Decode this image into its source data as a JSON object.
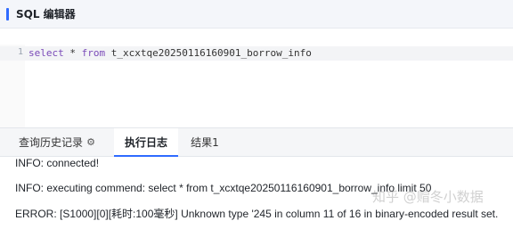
{
  "header": {
    "title": "SQL 编辑器"
  },
  "editor": {
    "line_number": "1",
    "tokens": {
      "kw_select": "select",
      "op_star": " * ",
      "kw_from": "from",
      "table": " t_xcxtqe20250116160901_borrow_info"
    }
  },
  "tabs": {
    "history_label": "查询历史记录",
    "exec_log_label": "执行日志",
    "result_label": "结果1"
  },
  "log": {
    "lines": [
      "INFO: connected!",
      "INFO: executing commend: select * from t_xcxtqe20250116160901_borrow_info limit 50",
      "ERROR: [S1000][0][耗时:100毫秒] Unknown type '245 in column 11 of 16 in binary-encoded result set."
    ]
  },
  "watermark": "知乎 @赗冬小数据"
}
